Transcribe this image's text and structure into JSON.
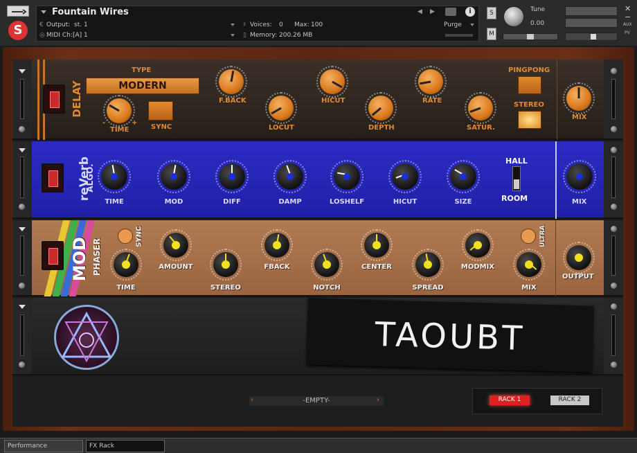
{
  "header": {
    "instrument_name": "Fountain Wires",
    "output_label": "Output:",
    "output_value": "st. 1",
    "midi_label": "MIDI Ch:",
    "midi_value": "[A]  1",
    "voices_label": "Voices:",
    "voices_value": "0",
    "max_label": "Max:",
    "max_value": "100",
    "memory_label": "Memory:",
    "memory_value": "200.26 MB",
    "purge_label": "Purge",
    "s_button": "S",
    "m_button": "M",
    "tune_label": "Tune",
    "tune_value": "0.00",
    "aux_label": "AUX",
    "pv_label": "PV"
  },
  "delay": {
    "title": "DELAY",
    "type_label": "TYPE",
    "type_value": "MODERN",
    "time_label": "TIME",
    "time_minus": "-",
    "time_plus": "+",
    "sync_label": "SYNC",
    "fback_label": "F.BACK",
    "locut_label": "LOCUT",
    "hicut_label": "HICUT",
    "depth_label": "DEPTH",
    "rate_label": "RATE",
    "satur_label": "SATUR.",
    "pingpong_label": "PINGPONG",
    "stereo_label": "STEREO",
    "mix_label": "MIX"
  },
  "reverb": {
    "title": "reVerb",
    "subtitle": "ALGO.",
    "knobs": [
      "TIME",
      "MOD",
      "DIFF",
      "DAMP",
      "LOSHELF",
      "HICUT",
      "SIZE"
    ],
    "hall_label": "HALL",
    "room_label": "ROOM",
    "mix_label": "MIX"
  },
  "mod": {
    "title": "MOD",
    "subtitle": "PHASER",
    "sync_label": "SYNC",
    "time_label": "TIME",
    "amount_label": "AMOUNT",
    "stereo_label": "STEREO",
    "fback_label": "FBACK",
    "notch_label": "NOTCH",
    "center_label": "CENTER",
    "spread_label": "SPREAD",
    "modmix_label": "MODMIX",
    "mix_label": "MIX",
    "ultra_label": "ULTRA",
    "output_label": "OUTPUT"
  },
  "brand": {
    "logo_text": "TAOUBT"
  },
  "footer": {
    "empty_slot": "-EMPTY-",
    "rack1": "RACK 1",
    "rack2": "RACK 2"
  },
  "tabs": [
    "Performance",
    "FX Rack"
  ],
  "colors": {
    "reverb_blue": "#2626b8",
    "mod_tan": "#a8704a",
    "delay_dark": "#2c2620",
    "orange_accent": "#e08a30",
    "active_rack_red": "#e02020"
  }
}
